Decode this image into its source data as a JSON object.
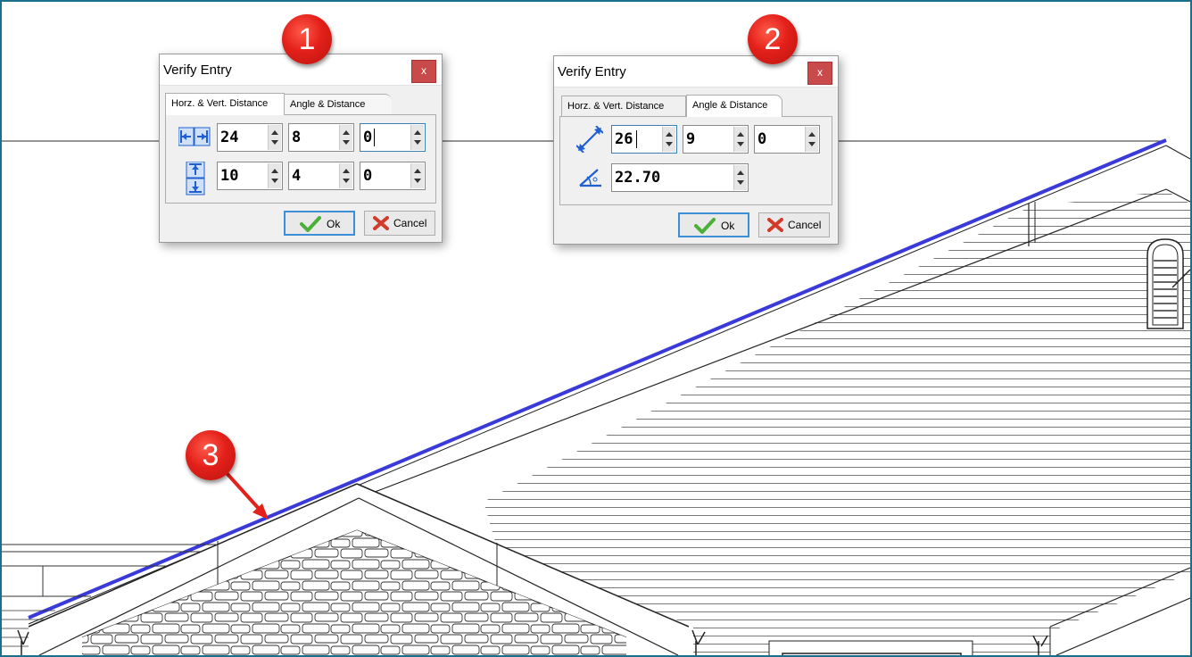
{
  "dialog_left": {
    "title": "Verify Entry",
    "close_label": "x",
    "tabs": [
      {
        "label": "Horz. & Vert. Distance",
        "active": true
      },
      {
        "label": "Angle & Distance",
        "active": false
      }
    ],
    "rows": [
      {
        "icon": "horizontal-distance-icon",
        "values": [
          "24",
          "8",
          "0"
        ]
      },
      {
        "icon": "vertical-distance-icon",
        "values": [
          "10",
          "4",
          "0"
        ]
      }
    ],
    "ok_label": "Ok",
    "cancel_label": "Cancel"
  },
  "dialog_right": {
    "title": "Verify Entry",
    "close_label": "x",
    "tabs": [
      {
        "label": "Horz. & Vert. Distance",
        "active": false
      },
      {
        "label": "Angle & Distance",
        "active": true
      }
    ],
    "distance_values": [
      "26",
      "9",
      "0"
    ],
    "angle_value": "22.70",
    "ok_label": "Ok",
    "cancel_label": "Cancel"
  },
  "callouts": [
    "1",
    "2",
    "3"
  ],
  "colors": {
    "frame_border": "#1b6f8a",
    "selected_roof_line": "#3a3ad8",
    "callout_red": "#e3201a",
    "icon_blue": "#1f5fd1",
    "ok_check": "#4caf3a",
    "cancel_x": "#d23a2a"
  }
}
